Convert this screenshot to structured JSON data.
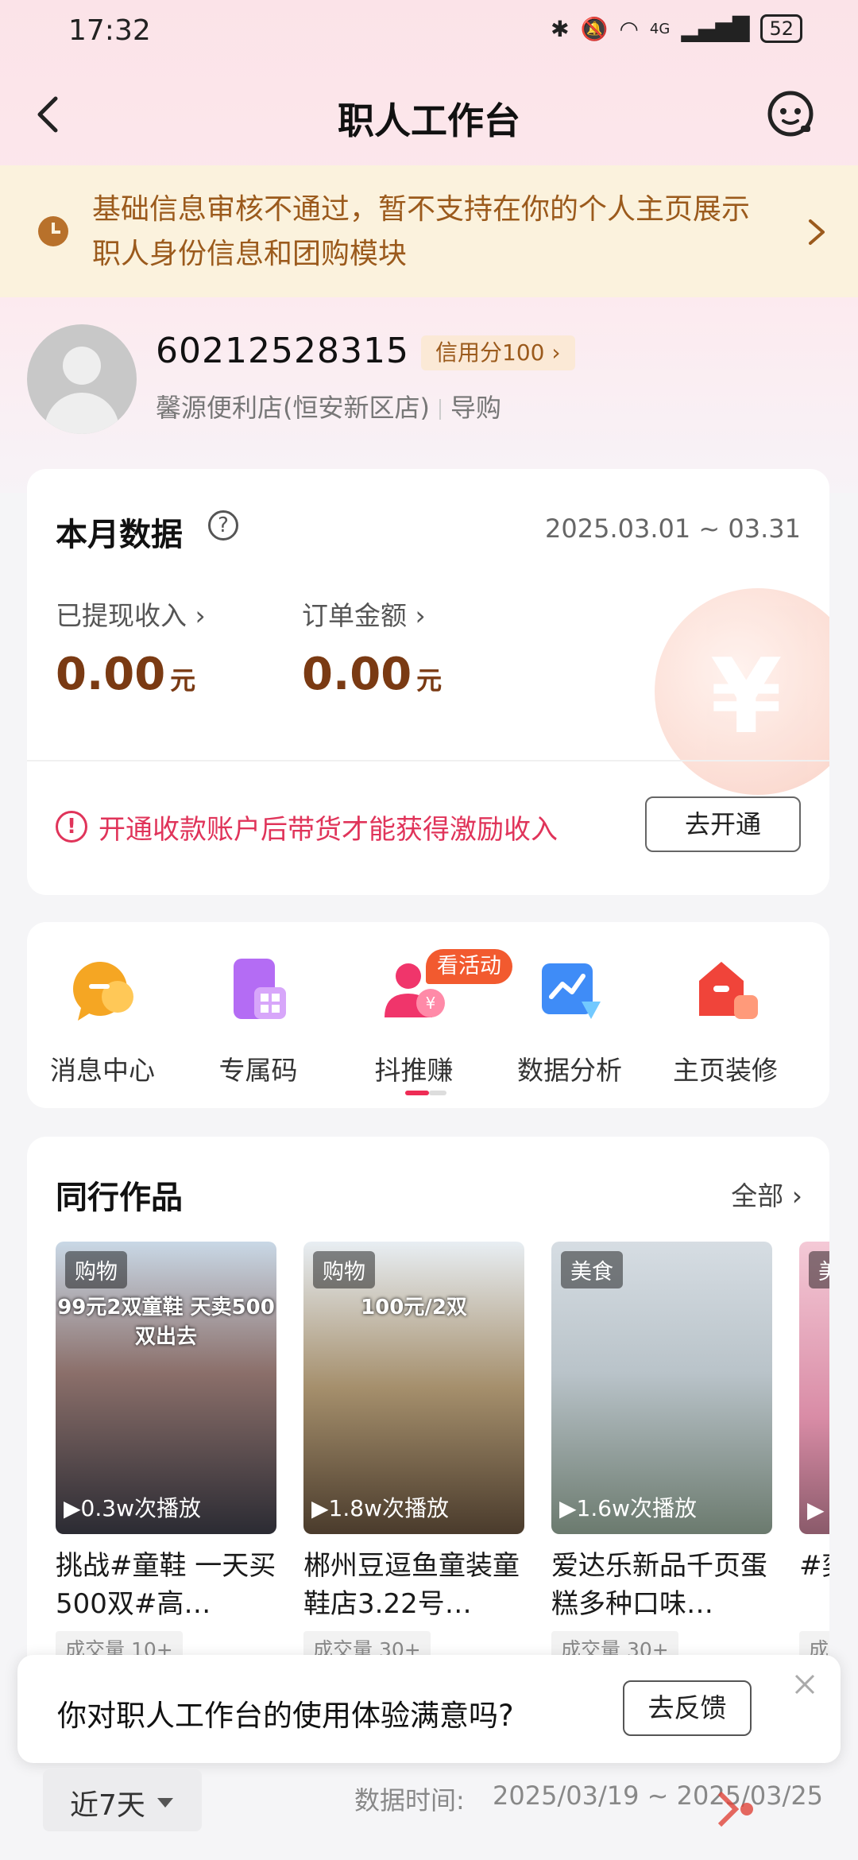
{
  "status_bar": {
    "time": "17:32",
    "network": "4G",
    "battery": "52"
  },
  "nav": {
    "title": "职人工作台"
  },
  "notice": {
    "text": "基础信息审核不通过，暂不支持在你的个人主页展示职人身份信息和团购模块"
  },
  "profile": {
    "username": "60212528315",
    "credit": "信用分100",
    "store": "馨源便利店(恒安新区店)",
    "role": "导购"
  },
  "month_data": {
    "title": "本月数据",
    "date_range": "2025.03.01 ~ 03.31",
    "metrics": [
      {
        "label": "已提现收入",
        "value": "0.00",
        "unit": "元"
      },
      {
        "label": "订单金额",
        "value": "0.00",
        "unit": "元"
      }
    ],
    "warning": "开通收款账户后带货才能获得激励收入",
    "open_button": "去开通"
  },
  "tools": {
    "badge": "看活动",
    "items": [
      {
        "label": "消息中心",
        "icon": "message-icon",
        "color": "#f5a623"
      },
      {
        "label": "专属码",
        "icon": "qrcode-icon",
        "color": "#b46cf4"
      },
      {
        "label": "抖推赚",
        "icon": "promote-earn-icon",
        "color": "#f0356b"
      },
      {
        "label": "数据分析",
        "icon": "chart-icon",
        "color": "#3f8cf7"
      },
      {
        "label": "主页装修",
        "icon": "home-decor-icon",
        "color": "#f0443a"
      }
    ]
  },
  "works": {
    "title": "同行作品",
    "all_label": "全部",
    "items": [
      {
        "tag": "购物",
        "headline": "99元2双童鞋 天卖500双出去",
        "plays": "0.3w次播放",
        "title": "挑战#童鞋 一天买500双#高…",
        "deal": "成交量 10+"
      },
      {
        "tag": "购物",
        "headline": "100元/2双",
        "plays": "1.8w次播放",
        "title": "郴州豆逗鱼童装童鞋店3.22号…",
        "deal": "成交量 30+"
      },
      {
        "tag": "美食",
        "headline": "",
        "plays": "1.6w次播放",
        "title": "爱达乐新品千页蛋糕多种口味…",
        "deal": "成交量 30+"
      },
      {
        "tag": "美",
        "headline": "",
        "plays": "",
        "title": "#奕认",
        "deal": "成"
      }
    ]
  },
  "survey": {
    "question": "你对职人工作台的使用体验满意吗?",
    "button": "去反馈"
  },
  "footer": {
    "period": "近7天",
    "data_time_label": "数据时间:",
    "data_time_value": "2025/03/19 ~ 2025/03/25"
  },
  "colors": {
    "accent": "#ee2c55",
    "notice_text": "#9b5a1c",
    "metric_value": "#7a3a13"
  }
}
